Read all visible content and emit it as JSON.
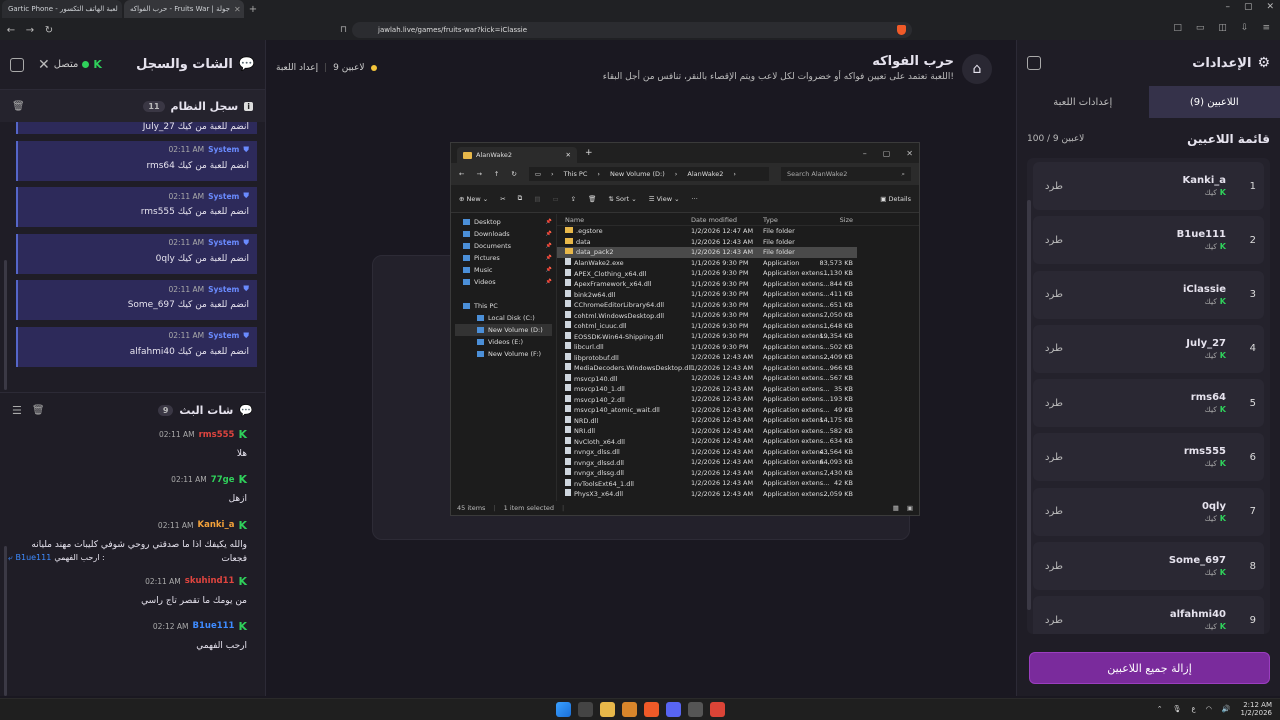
{
  "browser": {
    "tabs": [
      {
        "label": "Gartic Phone - لعبة الهاتف التكسور",
        "active": false
      },
      {
        "label": "حرب الفواكه - Fruits War | جولة",
        "active": true
      }
    ],
    "url": "jawlah.live/games/fruits-war?kick=iClassie"
  },
  "left": {
    "title": "الشات والسجل",
    "status": "متصل",
    "system_log": {
      "title": "سجل النظام",
      "count": "11",
      "cut_text": "July_27 انضم للعبة من كيك",
      "messages": [
        {
          "who": "System",
          "time": "02:11 AM",
          "text": "rms64 انضم للعبة من كيك"
        },
        {
          "who": "System",
          "time": "02:11 AM",
          "text": "rms555 انضم للعبة من كيك"
        },
        {
          "who": "System",
          "time": "02:11 AM",
          "text": "0qly انضم للعبة من كيك"
        },
        {
          "who": "System",
          "time": "02:11 AM",
          "text": "Some_697 انضم للعبة من كيك"
        },
        {
          "who": "System",
          "time": "02:11 AM",
          "text": "alfahmi40 انضم للعبة من كيك"
        }
      ]
    },
    "broadcast": {
      "title": "شات البث",
      "count": "9",
      "messages": [
        {
          "name": "rms555",
          "color": "#e0453f",
          "time": "02:11 AM",
          "text": "هلا"
        },
        {
          "name": "77ge",
          "color": "#2fd15b",
          "time": "02:11 AM",
          "text": "ازهل"
        },
        {
          "name": "Kanki_a",
          "color": "#f3a23a",
          "time": "02:11 AM",
          "text": "والله يكيفك اذا ما صدقتي روحي شوفي كليبات مهند مليانه فجعات",
          "mention_name": "B1ue111",
          "mention_text": "ارحب الفهمي :"
        },
        {
          "name": "skuhind11",
          "color": "#e0453f",
          "time": "02:11 AM",
          "text": "من يومك ما تقصر تاج راسي"
        },
        {
          "name": "B1ue111",
          "color": "#3e8bff",
          "time": "02:12 AM",
          "text": "ارحب الفهمي"
        }
      ]
    }
  },
  "game": {
    "title": "حرب الفواكه",
    "description": "اللعبة تعتمد على تعيين فواكه أو خضروات لكل لاعب ويتم الإقصاء بالنقر، تنافس من أجل البقاء!",
    "players_count": "9 لاعبين",
    "settings_link": "إعداد اللعبة"
  },
  "explorer": {
    "tab": "AlanWake2",
    "path": [
      "This PC",
      "New Volume (D:)",
      "AlanWake2"
    ],
    "search": "Search AlanWake2",
    "cmd": {
      "new": "New",
      "sort": "Sort",
      "view": "View",
      "details": "Details"
    },
    "sidebar": [
      {
        "label": "Desktop",
        "pinned": true,
        "sub": false
      },
      {
        "label": "Downloads",
        "pinned": true,
        "sub": false
      },
      {
        "label": "Documents",
        "pinned": true,
        "sub": false
      },
      {
        "label": "Pictures",
        "pinned": true,
        "sub": false
      },
      {
        "label": "Music",
        "pinned": true,
        "sub": false
      },
      {
        "label": "Videos",
        "pinned": true,
        "sub": false
      },
      {
        "label": "",
        "pinned": false,
        "sub": false
      },
      {
        "label": "This PC",
        "pinned": false,
        "sub": false
      },
      {
        "label": "Local Disk (C:)",
        "pinned": false,
        "sub": true
      },
      {
        "label": "New Volume (D:)",
        "pinned": false,
        "sub": true,
        "selected": true
      },
      {
        "label": "Videos (E:)",
        "pinned": false,
        "sub": true
      },
      {
        "label": "New Volume (F:)",
        "pinned": false,
        "sub": true
      }
    ],
    "columns": [
      "Name",
      "Date modified",
      "Type",
      "Size"
    ],
    "rows": [
      [
        ".egstore",
        "1/2/2026 12:47 AM",
        "File folder",
        ""
      ],
      [
        "data",
        "1/2/2026 12:43 AM",
        "File folder",
        ""
      ],
      [
        "data_pack2",
        "1/2/2026 12:43 AM",
        "File folder",
        ""
      ],
      [
        "AlanWake2.exe",
        "1/1/2026 9:30 PM",
        "Application",
        "83,573 KB"
      ],
      [
        "APEX_Clothing_x64.dll",
        "1/1/2026 9:30 PM",
        "Application extens...",
        "1,130 KB"
      ],
      [
        "ApexFramework_x64.dll",
        "1/1/2026 9:30 PM",
        "Application extens...",
        "844 KB"
      ],
      [
        "bink2w64.dll",
        "1/1/2026 9:30 PM",
        "Application extens...",
        "411 KB"
      ],
      [
        "CChromeEditorLibrary64.dll",
        "1/1/2026 9:30 PM",
        "Application extens...",
        "651 KB"
      ],
      [
        "cohtml.WindowsDesktop.dll",
        "1/1/2026 9:30 PM",
        "Application extens...",
        "7,050 KB"
      ],
      [
        "cohtml_icuuc.dll",
        "1/1/2026 9:30 PM",
        "Application extens...",
        "1,648 KB"
      ],
      [
        "EOSSDK-Win64-Shipping.dll",
        "1/1/2026 9:30 PM",
        "Application extens...",
        "19,354 KB"
      ],
      [
        "libcurl.dll",
        "1/1/2026 9:30 PM",
        "Application extens...",
        "502 KB"
      ],
      [
        "libprotobuf.dll",
        "1/2/2026 12:43 AM",
        "Application extens...",
        "2,409 KB"
      ],
      [
        "MediaDecoders.WindowsDesktop.dll",
        "1/2/2026 12:43 AM",
        "Application extens...",
        "966 KB"
      ],
      [
        "msvcp140.dll",
        "1/2/2026 12:43 AM",
        "Application extens...",
        "567 KB"
      ],
      [
        "msvcp140_1.dll",
        "1/2/2026 12:43 AM",
        "Application extens...",
        "35 KB"
      ],
      [
        "msvcp140_2.dll",
        "1/2/2026 12:43 AM",
        "Application extens...",
        "193 KB"
      ],
      [
        "msvcp140_atomic_wait.dll",
        "1/2/2026 12:43 AM",
        "Application extens...",
        "49 KB"
      ],
      [
        "NRD.dll",
        "1/2/2026 12:43 AM",
        "Application extens...",
        "14,175 KB"
      ],
      [
        "NRI.dll",
        "1/2/2026 12:43 AM",
        "Application extens...",
        "582 KB"
      ],
      [
        "NvCloth_x64.dll",
        "1/2/2026 12:43 AM",
        "Application extens...",
        "634 KB"
      ],
      [
        "nvngx_dlss.dll",
        "1/2/2026 12:43 AM",
        "Application extens...",
        "43,564 KB"
      ],
      [
        "nvngx_dlssd.dll",
        "1/2/2026 12:43 AM",
        "Application extens...",
        "64,093 KB"
      ],
      [
        "nvngx_dlssg.dll",
        "1/2/2026 12:43 AM",
        "Application extens...",
        "7,430 KB"
      ],
      [
        "nvToolsExt64_1.dll",
        "1/2/2026 12:43 AM",
        "Application extens...",
        "42 KB"
      ],
      [
        "PhysX3_x64.dll",
        "1/2/2026 12:43 AM",
        "Application extens...",
        "2,059 KB"
      ]
    ],
    "selected_row": 2,
    "status_items": "45 items",
    "status_selected": "1 item selected"
  },
  "right": {
    "title": "الإعدادات",
    "tab_players": "اللاعبين (9)",
    "tab_settings": "إعدادات اللعبة",
    "list_title": "قائمة اللاعبين",
    "list_count": "100 / 9 لاعبين",
    "kick_label": "طرد",
    "source_label": "كيك",
    "players": [
      {
        "num": "1",
        "name": "Kanki_a"
      },
      {
        "num": "2",
        "name": "B1ue111"
      },
      {
        "num": "3",
        "name": "iClassie"
      },
      {
        "num": "4",
        "name": "July_27"
      },
      {
        "num": "5",
        "name": "rms64"
      },
      {
        "num": "6",
        "name": "rms555"
      },
      {
        "num": "7",
        "name": "0qly"
      },
      {
        "num": "8",
        "name": "Some_697"
      },
      {
        "num": "9",
        "name": "alfahmi40"
      }
    ],
    "remove_all": "إزالة جميع اللاعبين"
  },
  "taskbar": {
    "lang": "ع",
    "time": "2:12 AM",
    "date": "1/2/2026"
  }
}
